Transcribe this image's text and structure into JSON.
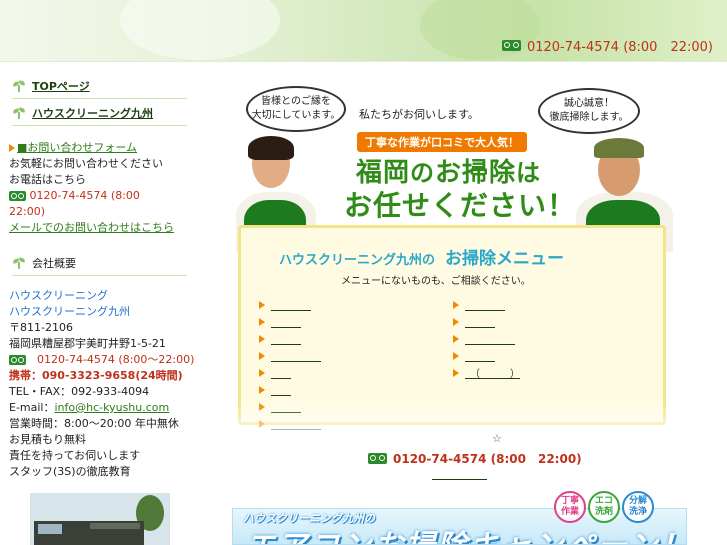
{
  "header": {
    "phone_icon": "free-dial-icon",
    "phone": "0120-74-4574 (8:00　22:00)"
  },
  "sidebar": {
    "nav": [
      {
        "label": "TOPページ"
      },
      {
        "label": "ハウスクリーニング九州"
      }
    ],
    "contact": {
      "line1": "■お問い合わせフォーム",
      "line2": "お気軽にお問い合わせください",
      "line3": "お電話はこちら",
      "phone_a": "0120-74-4574 (8:00",
      "phone_b": "22:00)",
      "mail_link": "メールでのお問い合わせはこちら"
    },
    "company_heading": "会社概要",
    "company": {
      "name1": "ハウスクリーニング",
      "name2": "ハウスクリーニング九州",
      "zip": "〒811-2106",
      "address": "福岡県糟屋郡宇美町井野1-5-21",
      "freedial": "　0120-74-4574 (8:00〜22:00)",
      "mobile": "携帯：090-3323-9658(24時間)",
      "telfax": "TEL・FAX：092-933-4094",
      "email_label": "E-mail：",
      "email": "info@hc-kyushu.com",
      "hours": "営業時間：8:00〜20:00 年中無休",
      "line_a": "お見積もり無料",
      "line_b": "責任を持ってお伺いします",
      "line_c": "スタッフ(3S)の徹底教育"
    }
  },
  "hero": {
    "bubble_left": [
      "皆様とのご縁を",
      "大切にしています。"
    ],
    "bubble_right": [
      "誠心誠意！",
      "徹底掃除します。"
    ],
    "tagline": "私たちがお伺いします。",
    "badge": "丁寧な作業が口コミで大人気！",
    "title1a": "福岡",
    "title1b": "の",
    "title1c": "お掃除",
    "title1d": "は",
    "title2": "お任せください！"
  },
  "menu": {
    "brand": "ハウスクリーニング九州の",
    "title": "お掃除メニュー",
    "subtitle": "メニューにないものも、ご相談ください。",
    "left_items": [
      "　　　　",
      "　　　",
      "　　　",
      "　　　　　",
      "　　",
      "　　",
      "　　　",
      "　　　　　"
    ],
    "right_items": [
      "　　　　",
      "　　　",
      "　　　　　",
      "　　　",
      "　（　　　）"
    ]
  },
  "main": {
    "star": "☆",
    "phone": "0120-74-4574 (8:00　22:00)"
  },
  "banner": {
    "brand": "ハウスクリーニング九州の",
    "title": "エアコンお掃除キャンペーン！",
    "badges": [
      {
        "line1": "丁寧",
        "line2": "作業",
        "color": "#e0408a"
      },
      {
        "line1": "エコ",
        "line2": "洗剤",
        "color": "#3aa53a"
      },
      {
        "line1": "分解",
        "line2": "洗浄",
        "color": "#2a8ad2"
      }
    ]
  }
}
